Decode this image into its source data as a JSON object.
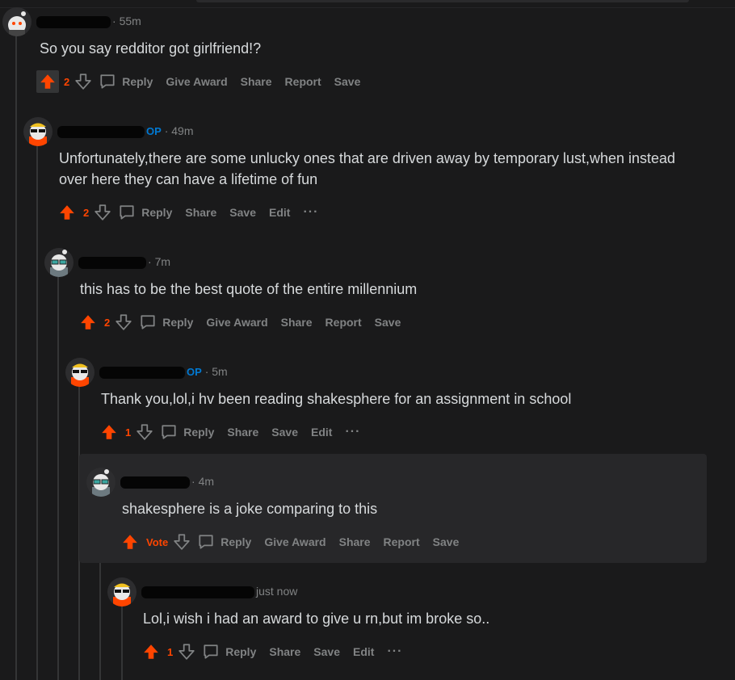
{
  "comments": [
    {
      "time": "55m",
      "op": "",
      "text": "So you say redditor got girlfriend!?",
      "score": "2",
      "actions": [
        "Reply",
        "Give Award",
        "Share",
        "Report",
        "Save"
      ],
      "more": ""
    },
    {
      "time": "49m",
      "op": "OP",
      "text_lines": [
        "Unfortunately,there are some unlucky ones that are driven away by temporary lust,when instead",
        "over here they can have a lifetime of fun"
      ],
      "score": "2",
      "actions": [
        "Reply",
        "Share",
        "Save",
        "Edit"
      ],
      "more": "···"
    },
    {
      "time": "7m",
      "op": "",
      "text": "this has to be the best quote of the entire millennium",
      "score": "2",
      "actions": [
        "Reply",
        "Give Award",
        "Share",
        "Report",
        "Save"
      ],
      "more": ""
    },
    {
      "time": "5m",
      "op": "OP",
      "text": "Thank you,lol,i hv been reading shakesphere for an assignment in school",
      "score": "1",
      "actions": [
        "Reply",
        "Share",
        "Save",
        "Edit"
      ],
      "more": "···"
    },
    {
      "time": "4m",
      "op": "",
      "text": "shakesphere is a joke comparing to this",
      "score": "Vote",
      "actions": [
        "Reply",
        "Give Award",
        "Share",
        "Report",
        "Save"
      ],
      "more": ""
    },
    {
      "time": "just now",
      "op": "",
      "text": "Lol,i wish i had an award to give u rn,but im broke so..",
      "score": "1",
      "actions": [
        "Reply",
        "Share",
        "Save",
        "Edit"
      ],
      "more": "···"
    }
  ],
  "meta_separator": "·",
  "colors": {
    "upvote": "#ff4500",
    "op": "#0079d3",
    "text": "#d7dadc",
    "muted": "#818384"
  },
  "icons": [
    "upvote-arrow-icon",
    "downvote-arrow-icon",
    "comment-bubble-icon",
    "more-dots-icon"
  ]
}
